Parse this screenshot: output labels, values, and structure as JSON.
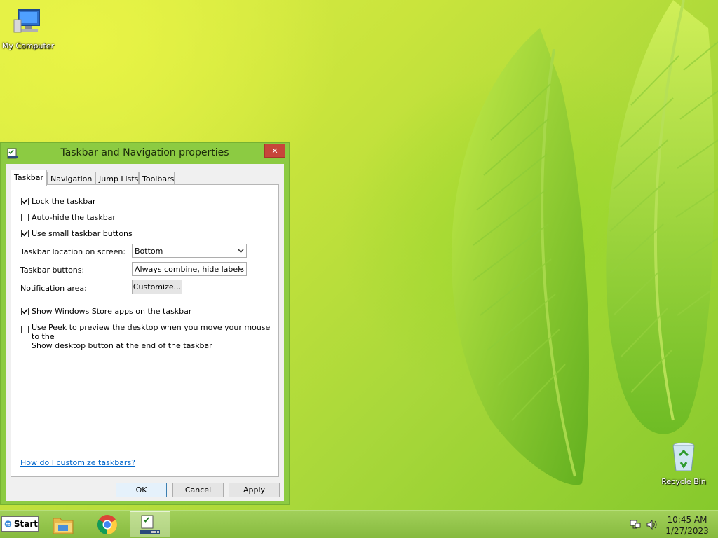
{
  "desktop": {
    "icons": [
      {
        "label": "My Computer"
      },
      {
        "label": "Recycle Bin"
      }
    ]
  },
  "window": {
    "title": "Taskbar and Navigation properties",
    "close_label": "✕",
    "tabs": [
      {
        "label": "Taskbar",
        "active": true
      },
      {
        "label": "Navigation",
        "active": false
      },
      {
        "label": "Jump Lists",
        "active": false
      },
      {
        "label": "Toolbars",
        "active": false
      }
    ],
    "taskbar_tab": {
      "lock": {
        "label": "Lock the taskbar",
        "checked": true
      },
      "autohide": {
        "label": "Auto-hide the taskbar",
        "checked": false
      },
      "small_buttons": {
        "label": "Use small taskbar buttons",
        "checked": true
      },
      "location": {
        "label": "Taskbar location on screen:",
        "value": "Bottom"
      },
      "buttons": {
        "label": "Taskbar buttons:",
        "value": "Always combine, hide labels"
      },
      "notification": {
        "label": "Notification area:",
        "button": "Customize..."
      },
      "store_apps": {
        "label": "Show Windows Store apps on the taskbar",
        "checked": true
      },
      "peek": {
        "label_line1": "Use Peek to preview the desktop when you move your mouse to the",
        "label_line2": "Show desktop button at the end of the taskbar",
        "checked": false
      },
      "help_link": "How do I customize taskbars?"
    },
    "buttons": {
      "ok": "OK",
      "cancel": "Cancel",
      "apply": "Apply"
    }
  },
  "taskbar": {
    "start_label": "Start",
    "clock_time": "10:45 AM",
    "clock_date": "1/27/2023",
    "apps": [
      "file-explorer-icon",
      "chrome-icon",
      "taskbar-properties-icon"
    ]
  },
  "colors": {
    "accent": "#8ccb42",
    "close": "#c7463a",
    "link": "#0066cc"
  }
}
